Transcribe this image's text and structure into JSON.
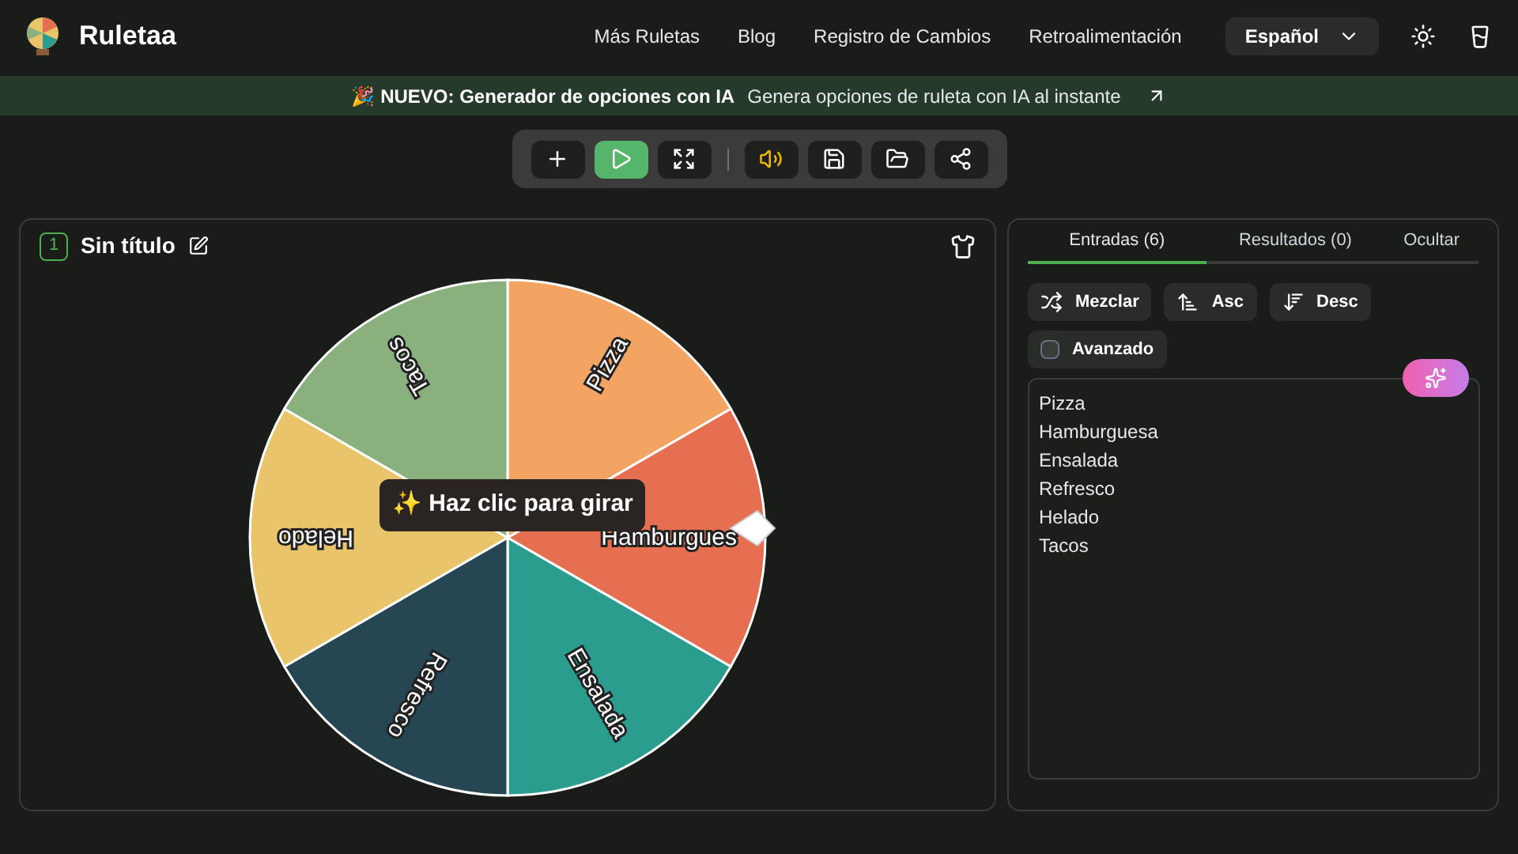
{
  "header": {
    "brand": "Ruletaa",
    "nav": [
      "Más Ruletas",
      "Blog",
      "Registro de Cambios",
      "Retroalimentación"
    ],
    "language": "Español"
  },
  "banner": {
    "emoji": "🎉",
    "title": "NUEVO: Generador de opciones con IA",
    "text": "Genera opciones de ruleta con IA al instante"
  },
  "toolbar": [
    {
      "kind": "add",
      "active": false
    },
    {
      "kind": "play",
      "active": true
    },
    {
      "kind": "fullscreen",
      "active": false
    },
    {
      "kind": "sound",
      "active": false
    },
    {
      "kind": "save",
      "active": false
    },
    {
      "kind": "open",
      "active": false
    },
    {
      "kind": "share",
      "active": false
    }
  ],
  "wheel_panel": {
    "number": "1",
    "title": "Sin título",
    "tooltip": "✨ Haz clic para girar",
    "segments": [
      {
        "label": "Pizza",
        "color": "#f3a462"
      },
      {
        "label": "Hamburgues",
        "color": "#e76f51"
      },
      {
        "label": "Ensalada",
        "color": "#2a9d8f"
      },
      {
        "label": "Refresco",
        "color": "#264653"
      },
      {
        "label": "Helado",
        "color": "#e9c46a"
      },
      {
        "label": "Tacos",
        "color": "#8ab17d"
      }
    ]
  },
  "entries_panel": {
    "tabs": [
      {
        "label": "Entradas (6)",
        "selected": true
      },
      {
        "label": "Resultados (0)",
        "selected": false
      },
      {
        "label": "Ocultar",
        "selected": false
      }
    ],
    "actions": [
      {
        "kind": "shuffle",
        "label": "Mezclar"
      },
      {
        "kind": "asc",
        "label": "Asc"
      },
      {
        "kind": "desc",
        "label": "Desc"
      }
    ],
    "advanced": {
      "label": "Avanzado",
      "checked": false
    },
    "entries": [
      "Pizza",
      "Hamburguesa",
      "Ensalada",
      "Refresco",
      "Helado",
      "Tacos"
    ]
  }
}
